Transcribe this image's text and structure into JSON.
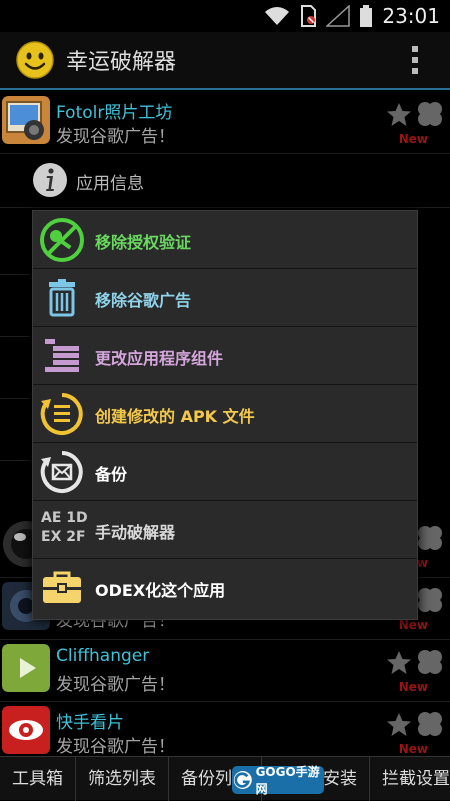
{
  "status_bar": {
    "time": "23:01"
  },
  "app_bar": {
    "title": "幸运破解器"
  },
  "apps": [
    {
      "name": "Fotolr照片工坊",
      "subtitle": "发现谷歌广告！",
      "badge": "New"
    },
    {
      "name": "",
      "subtitle": "",
      "badge": "New"
    },
    {
      "name": "",
      "subtitle": "发现谷歌广告！",
      "badge": "New"
    },
    {
      "name": "Cliffhanger",
      "subtitle": "发现谷歌广告！",
      "badge": "New"
    },
    {
      "name": "快手看片",
      "subtitle": "发现谷歌广告！",
      "badge": "New"
    }
  ],
  "info_row": {
    "label": "应用信息"
  },
  "context_menu": {
    "items": [
      {
        "label": "移除授权验证",
        "icon": "remove-license-icon",
        "color": "#68d85f"
      },
      {
        "label": "移除谷歌广告",
        "icon": "trash-icon",
        "color": "#8fd3ea"
      },
      {
        "label": "更改应用程序组件",
        "icon": "components-icon",
        "color": "#d4a6dc"
      },
      {
        "label": "创建修改的 APK 文件",
        "icon": "create-apk-icon",
        "color": "#f3c84b"
      },
      {
        "label": "备份",
        "icon": "backup-icon",
        "color": "#ffffff"
      },
      {
        "label": "手动破解器",
        "icon": "ae-code-icon",
        "color": "#d9d9d9",
        "code_lines": [
          "AE 1D",
          "EX 2F"
        ]
      },
      {
        "label": "ODEX化这个应用",
        "icon": "toolbox-icon",
        "color": "#ffffff"
      }
    ]
  },
  "bottom_tabs": [
    "工具箱",
    "筛选列表",
    "备份列表",
    "和安装",
    "拦截设置"
  ],
  "watermark": {
    "text": "GOGO手游网"
  }
}
